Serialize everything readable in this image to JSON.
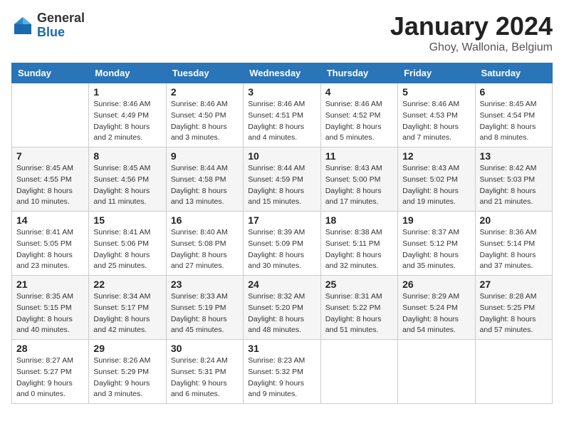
{
  "logo": {
    "general": "General",
    "blue": "Blue"
  },
  "title": "January 2024",
  "location": "Ghoy, Wallonia, Belgium",
  "days_of_week": [
    "Sunday",
    "Monday",
    "Tuesday",
    "Wednesday",
    "Thursday",
    "Friday",
    "Saturday"
  ],
  "weeks": [
    [
      {
        "day": "",
        "info": ""
      },
      {
        "day": "1",
        "info": "Sunrise: 8:46 AM\nSunset: 4:49 PM\nDaylight: 8 hours\nand 2 minutes."
      },
      {
        "day": "2",
        "info": "Sunrise: 8:46 AM\nSunset: 4:50 PM\nDaylight: 8 hours\nand 3 minutes."
      },
      {
        "day": "3",
        "info": "Sunrise: 8:46 AM\nSunset: 4:51 PM\nDaylight: 8 hours\nand 4 minutes."
      },
      {
        "day": "4",
        "info": "Sunrise: 8:46 AM\nSunset: 4:52 PM\nDaylight: 8 hours\nand 5 minutes."
      },
      {
        "day": "5",
        "info": "Sunrise: 8:46 AM\nSunset: 4:53 PM\nDaylight: 8 hours\nand 7 minutes."
      },
      {
        "day": "6",
        "info": "Sunrise: 8:45 AM\nSunset: 4:54 PM\nDaylight: 8 hours\nand 8 minutes."
      }
    ],
    [
      {
        "day": "7",
        "info": "Sunrise: 8:45 AM\nSunset: 4:55 PM\nDaylight: 8 hours\nand 10 minutes."
      },
      {
        "day": "8",
        "info": "Sunrise: 8:45 AM\nSunset: 4:56 PM\nDaylight: 8 hours\nand 11 minutes."
      },
      {
        "day": "9",
        "info": "Sunrise: 8:44 AM\nSunset: 4:58 PM\nDaylight: 8 hours\nand 13 minutes."
      },
      {
        "day": "10",
        "info": "Sunrise: 8:44 AM\nSunset: 4:59 PM\nDaylight: 8 hours\nand 15 minutes."
      },
      {
        "day": "11",
        "info": "Sunrise: 8:43 AM\nSunset: 5:00 PM\nDaylight: 8 hours\nand 17 minutes."
      },
      {
        "day": "12",
        "info": "Sunrise: 8:43 AM\nSunset: 5:02 PM\nDaylight: 8 hours\nand 19 minutes."
      },
      {
        "day": "13",
        "info": "Sunrise: 8:42 AM\nSunset: 5:03 PM\nDaylight: 8 hours\nand 21 minutes."
      }
    ],
    [
      {
        "day": "14",
        "info": "Sunrise: 8:41 AM\nSunset: 5:05 PM\nDaylight: 8 hours\nand 23 minutes."
      },
      {
        "day": "15",
        "info": "Sunrise: 8:41 AM\nSunset: 5:06 PM\nDaylight: 8 hours\nand 25 minutes."
      },
      {
        "day": "16",
        "info": "Sunrise: 8:40 AM\nSunset: 5:08 PM\nDaylight: 8 hours\nand 27 minutes."
      },
      {
        "day": "17",
        "info": "Sunrise: 8:39 AM\nSunset: 5:09 PM\nDaylight: 8 hours\nand 30 minutes."
      },
      {
        "day": "18",
        "info": "Sunrise: 8:38 AM\nSunset: 5:11 PM\nDaylight: 8 hours\nand 32 minutes."
      },
      {
        "day": "19",
        "info": "Sunrise: 8:37 AM\nSunset: 5:12 PM\nDaylight: 8 hours\nand 35 minutes."
      },
      {
        "day": "20",
        "info": "Sunrise: 8:36 AM\nSunset: 5:14 PM\nDaylight: 8 hours\nand 37 minutes."
      }
    ],
    [
      {
        "day": "21",
        "info": "Sunrise: 8:35 AM\nSunset: 5:15 PM\nDaylight: 8 hours\nand 40 minutes."
      },
      {
        "day": "22",
        "info": "Sunrise: 8:34 AM\nSunset: 5:17 PM\nDaylight: 8 hours\nand 42 minutes."
      },
      {
        "day": "23",
        "info": "Sunrise: 8:33 AM\nSunset: 5:19 PM\nDaylight: 8 hours\nand 45 minutes."
      },
      {
        "day": "24",
        "info": "Sunrise: 8:32 AM\nSunset: 5:20 PM\nDaylight: 8 hours\nand 48 minutes."
      },
      {
        "day": "25",
        "info": "Sunrise: 8:31 AM\nSunset: 5:22 PM\nDaylight: 8 hours\nand 51 minutes."
      },
      {
        "day": "26",
        "info": "Sunrise: 8:29 AM\nSunset: 5:24 PM\nDaylight: 8 hours\nand 54 minutes."
      },
      {
        "day": "27",
        "info": "Sunrise: 8:28 AM\nSunset: 5:25 PM\nDaylight: 8 hours\nand 57 minutes."
      }
    ],
    [
      {
        "day": "28",
        "info": "Sunrise: 8:27 AM\nSunset: 5:27 PM\nDaylight: 9 hours\nand 0 minutes."
      },
      {
        "day": "29",
        "info": "Sunrise: 8:26 AM\nSunset: 5:29 PM\nDaylight: 9 hours\nand 3 minutes."
      },
      {
        "day": "30",
        "info": "Sunrise: 8:24 AM\nSunset: 5:31 PM\nDaylight: 9 hours\nand 6 minutes."
      },
      {
        "day": "31",
        "info": "Sunrise: 8:23 AM\nSunset: 5:32 PM\nDaylight: 9 hours\nand 9 minutes."
      },
      {
        "day": "",
        "info": ""
      },
      {
        "day": "",
        "info": ""
      },
      {
        "day": "",
        "info": ""
      }
    ]
  ]
}
